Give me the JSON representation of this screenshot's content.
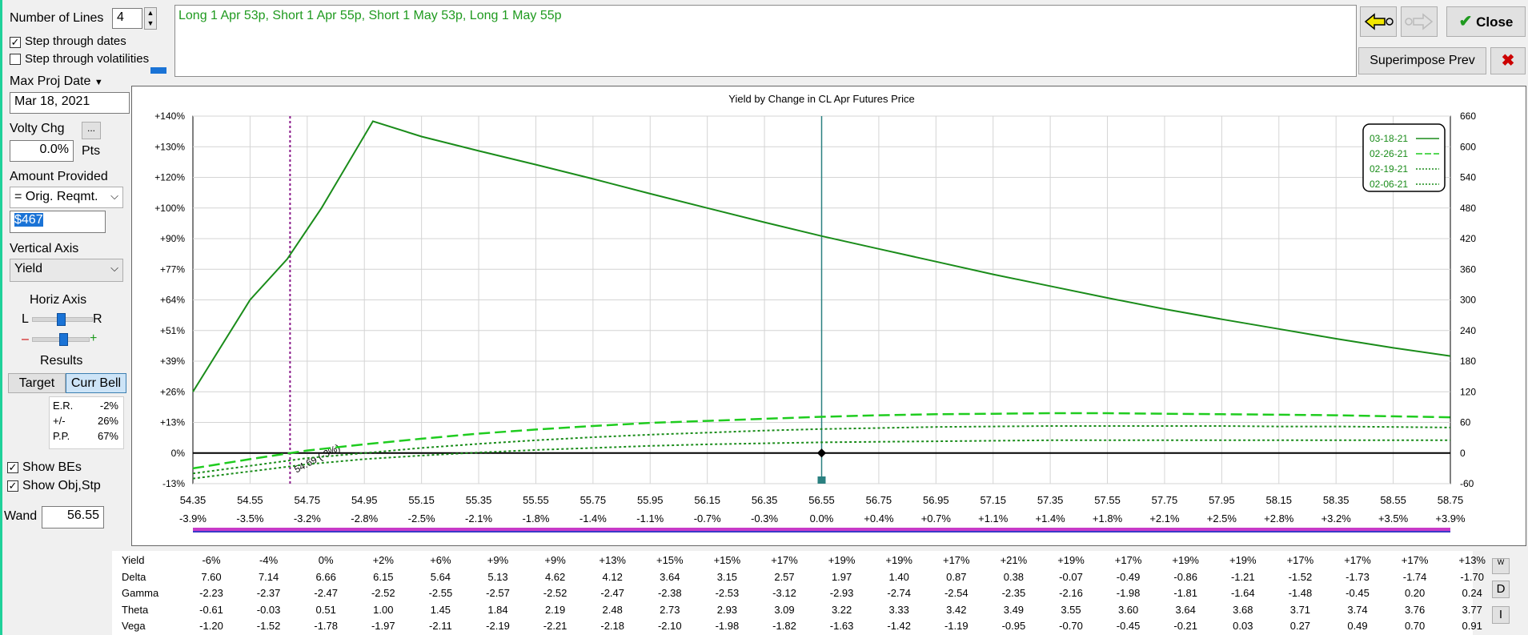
{
  "left_panel": {
    "number_of_lines_label": "Number of Lines",
    "number_of_lines_value": "4",
    "step_dates_label": "Step through dates",
    "step_dates_checked": true,
    "step_vols_label": "Step through volatilities",
    "step_vols_checked": false,
    "max_proj_date_label": "Max Proj Date",
    "max_proj_date_value": "Mar 18, 2021",
    "volty_chg_label": "Volty Chg",
    "volty_chg_btn": "...",
    "volty_chg_value": "0.0%",
    "volty_unit": "Pts",
    "amount_provided_label": "Amount Provided",
    "amount_provided_value": "= Orig. Reqmt.",
    "amount_value": "$467",
    "vertical_axis_label": "Vertical Axis",
    "vertical_axis_value": "Yield",
    "horiz_axis_label": "Horiz Axis",
    "horiz_l": "L",
    "horiz_r": "R",
    "horiz_minus": "–",
    "horiz_plus": "+",
    "results_label": "Results",
    "target_btn": "Target",
    "curr_bell_btn": "Curr Bell",
    "results": [
      {
        "k": "E.R.",
        "v": "-2%"
      },
      {
        "k": "+/-",
        "v": "26%"
      },
      {
        "k": "P.P.",
        "v": "67%"
      }
    ],
    "show_bes_label": "Show BEs",
    "show_bes_checked": true,
    "show_obj_label": "Show Obj,Stp",
    "show_obj_checked": true,
    "wand_label": "Wand",
    "wand_value": "56.55"
  },
  "header": {
    "strategy_text": "Long 1 Apr 53p, Short 1 Apr 55p, Short 1 May 53p, Long 1 May 55p",
    "close_label": "Close",
    "superimpose_label": "Superimpose Prev",
    "colors": {
      "strategy_text": "#1f9a1f",
      "close_check": "#1f9a1f",
      "close_x": "#cc0000"
    }
  },
  "chart_data": {
    "type": "line",
    "title": "Yield by Change in CL Apr Futures Price",
    "x_ticks": [
      "54.35",
      "54.55",
      "54.75",
      "54.95",
      "55.15",
      "55.35",
      "55.55",
      "55.75",
      "55.95",
      "56.15",
      "56.35",
      "56.55",
      "56.75",
      "56.95",
      "57.15",
      "57.35",
      "57.55",
      "57.75",
      "57.95",
      "58.15",
      "58.35",
      "58.55",
      "58.75"
    ],
    "x_pct_ticks": [
      "-3.9%",
      "-3.5%",
      "-3.2%",
      "-2.8%",
      "-2.5%",
      "-2.1%",
      "-1.8%",
      "-1.4%",
      "-1.1%",
      "-0.7%",
      "-0.3%",
      "0.0%",
      "+0.4%",
      "+0.7%",
      "+1.1%",
      "+1.4%",
      "+1.8%",
      "+2.1%",
      "+2.5%",
      "+2.8%",
      "+3.2%",
      "+3.5%",
      "+3.9%"
    ],
    "y_left_ticks": [
      "+140%",
      "+130%",
      "+120%",
      "+100%",
      "+90%",
      "+77%",
      "+64%",
      "+51%",
      "+39%",
      "+26%",
      "+13%",
      "0%",
      "-13%"
    ],
    "y_right_ticks": [
      "660",
      "600",
      "540",
      "480",
      "420",
      "360",
      "300",
      "240",
      "180",
      "120",
      "60",
      "0",
      "-60"
    ],
    "ylim_right": [
      -60,
      660
    ],
    "xlim": [
      54.35,
      58.75
    ],
    "grid": true,
    "legend_position": "top-right",
    "series": [
      {
        "name": "03-18-21",
        "color": "#1a8c1a",
        "style": "solid",
        "points": [
          [
            54.35,
            120
          ],
          [
            54.55,
            300
          ],
          [
            54.68,
            380
          ],
          [
            54.8,
            480
          ],
          [
            54.98,
            650
          ],
          [
            55.15,
            620
          ],
          [
            55.35,
            592
          ],
          [
            55.55,
            565
          ],
          [
            55.75,
            537
          ],
          [
            55.95,
            508
          ],
          [
            56.15,
            480
          ],
          [
            56.35,
            452
          ],
          [
            56.55,
            425
          ],
          [
            56.75,
            400
          ],
          [
            56.95,
            375
          ],
          [
            57.15,
            350
          ],
          [
            57.35,
            327
          ],
          [
            57.55,
            304
          ],
          [
            57.75,
            282
          ],
          [
            57.95,
            262
          ],
          [
            58.15,
            243
          ],
          [
            58.35,
            224
          ],
          [
            58.55,
            206
          ],
          [
            58.75,
            190
          ]
        ]
      },
      {
        "name": "02-26-21",
        "color": "#1fcc1f",
        "style": "longdash",
        "points": [
          [
            54.35,
            -30
          ],
          [
            54.55,
            -12
          ],
          [
            54.75,
            5
          ],
          [
            54.95,
            17
          ],
          [
            55.15,
            28
          ],
          [
            55.35,
            38
          ],
          [
            55.55,
            46
          ],
          [
            55.75,
            53
          ],
          [
            55.95,
            59
          ],
          [
            56.15,
            63
          ],
          [
            56.35,
            67
          ],
          [
            56.55,
            71
          ],
          [
            56.75,
            74
          ],
          [
            56.95,
            76
          ],
          [
            57.15,
            77
          ],
          [
            57.35,
            78
          ],
          [
            57.55,
            78
          ],
          [
            57.75,
            77
          ],
          [
            57.95,
            76
          ],
          [
            58.15,
            75
          ],
          [
            58.35,
            74
          ],
          [
            58.55,
            72
          ],
          [
            58.75,
            70
          ]
        ]
      },
      {
        "name": "02-19-21",
        "color": "#1a8c1a",
        "style": "dotted",
        "points": [
          [
            54.35,
            -40
          ],
          [
            54.55,
            -25
          ],
          [
            54.75,
            -10
          ],
          [
            54.95,
            0
          ],
          [
            55.15,
            10
          ],
          [
            55.35,
            18
          ],
          [
            55.55,
            25
          ],
          [
            55.75,
            31
          ],
          [
            55.95,
            36
          ],
          [
            56.15,
            40
          ],
          [
            56.35,
            44
          ],
          [
            56.55,
            47
          ],
          [
            56.75,
            49
          ],
          [
            56.95,
            51
          ],
          [
            57.15,
            52
          ],
          [
            57.35,
            53
          ],
          [
            57.55,
            53
          ],
          [
            57.75,
            53
          ],
          [
            57.95,
            53
          ],
          [
            58.15,
            52
          ],
          [
            58.35,
            52
          ],
          [
            58.55,
            51
          ],
          [
            58.75,
            50
          ]
        ]
      },
      {
        "name": "02-06-21",
        "color": "#1a8c1a",
        "style": "dotted",
        "points": [
          [
            54.35,
            -50
          ],
          [
            54.55,
            -36
          ],
          [
            54.75,
            -22
          ],
          [
            54.95,
            -12
          ],
          [
            55.15,
            -5
          ],
          [
            55.35,
            1
          ],
          [
            55.55,
            6
          ],
          [
            55.75,
            10
          ],
          [
            55.95,
            14
          ],
          [
            56.15,
            17
          ],
          [
            56.35,
            19
          ],
          [
            56.55,
            21
          ],
          [
            56.75,
            22
          ],
          [
            56.95,
            23
          ],
          [
            57.15,
            24
          ],
          [
            57.35,
            25
          ],
          [
            57.55,
            25
          ],
          [
            57.75,
            25
          ],
          [
            57.95,
            25
          ],
          [
            58.15,
            25
          ],
          [
            58.35,
            25
          ],
          [
            58.55,
            25
          ],
          [
            58.75,
            25
          ]
        ]
      }
    ],
    "breakeven": {
      "x": 54.69,
      "label": "54.69 (-3%)"
    },
    "current_price_x": 56.55
  },
  "table": {
    "row_labels": [
      "Yield",
      "Delta",
      "Gamma",
      "Theta",
      "Vega"
    ],
    "rows": [
      [
        "-6%",
        "-4%",
        "0%",
        "+2%",
        "+6%",
        "+9%",
        "+9%",
        "+13%",
        "+15%",
        "+15%",
        "+17%",
        "+19%",
        "+19%",
        "+17%",
        "+21%",
        "+19%",
        "+17%",
        "+19%",
        "+19%",
        "+17%",
        "+17%",
        "+17%",
        "+13%"
      ],
      [
        "7.60",
        "7.14",
        "6.66",
        "6.15",
        "5.64",
        "5.13",
        "4.62",
        "4.12",
        "3.64",
        "3.15",
        "2.57",
        "1.97",
        "1.40",
        "0.87",
        "0.38",
        "-0.07",
        "-0.49",
        "-0.86",
        "-1.21",
        "-1.52",
        "-1.73",
        "-1.74",
        "-1.70"
      ],
      [
        "-2.23",
        "-2.37",
        "-2.47",
        "-2.52",
        "-2.55",
        "-2.57",
        "-2.52",
        "-2.47",
        "-2.38",
        "-2.53",
        "-3.12",
        "-2.93",
        "-2.74",
        "-2.54",
        "-2.35",
        "-2.16",
        "-1.98",
        "-1.81",
        "-1.64",
        "-1.48",
        "-0.45",
        "0.20",
        "0.24"
      ],
      [
        "-0.61",
        "-0.03",
        "0.51",
        "1.00",
        "1.45",
        "1.84",
        "2.19",
        "2.48",
        "2.73",
        "2.93",
        "3.09",
        "3.22",
        "3.33",
        "3.42",
        "3.49",
        "3.55",
        "3.60",
        "3.64",
        "3.68",
        "3.71",
        "3.74",
        "3.76",
        "3.77"
      ],
      [
        "-1.20",
        "-1.52",
        "-1.78",
        "-1.97",
        "-2.11",
        "-2.19",
        "-2.21",
        "-2.18",
        "-2.10",
        "-1.98",
        "-1.82",
        "-1.63",
        "-1.42",
        "-1.19",
        "-0.95",
        "-0.70",
        "-0.45",
        "-0.21",
        "0.03",
        "0.27",
        "0.49",
        "0.70",
        "0.91"
      ]
    ],
    "side_buttons": [
      "W",
      "D",
      "I"
    ]
  }
}
